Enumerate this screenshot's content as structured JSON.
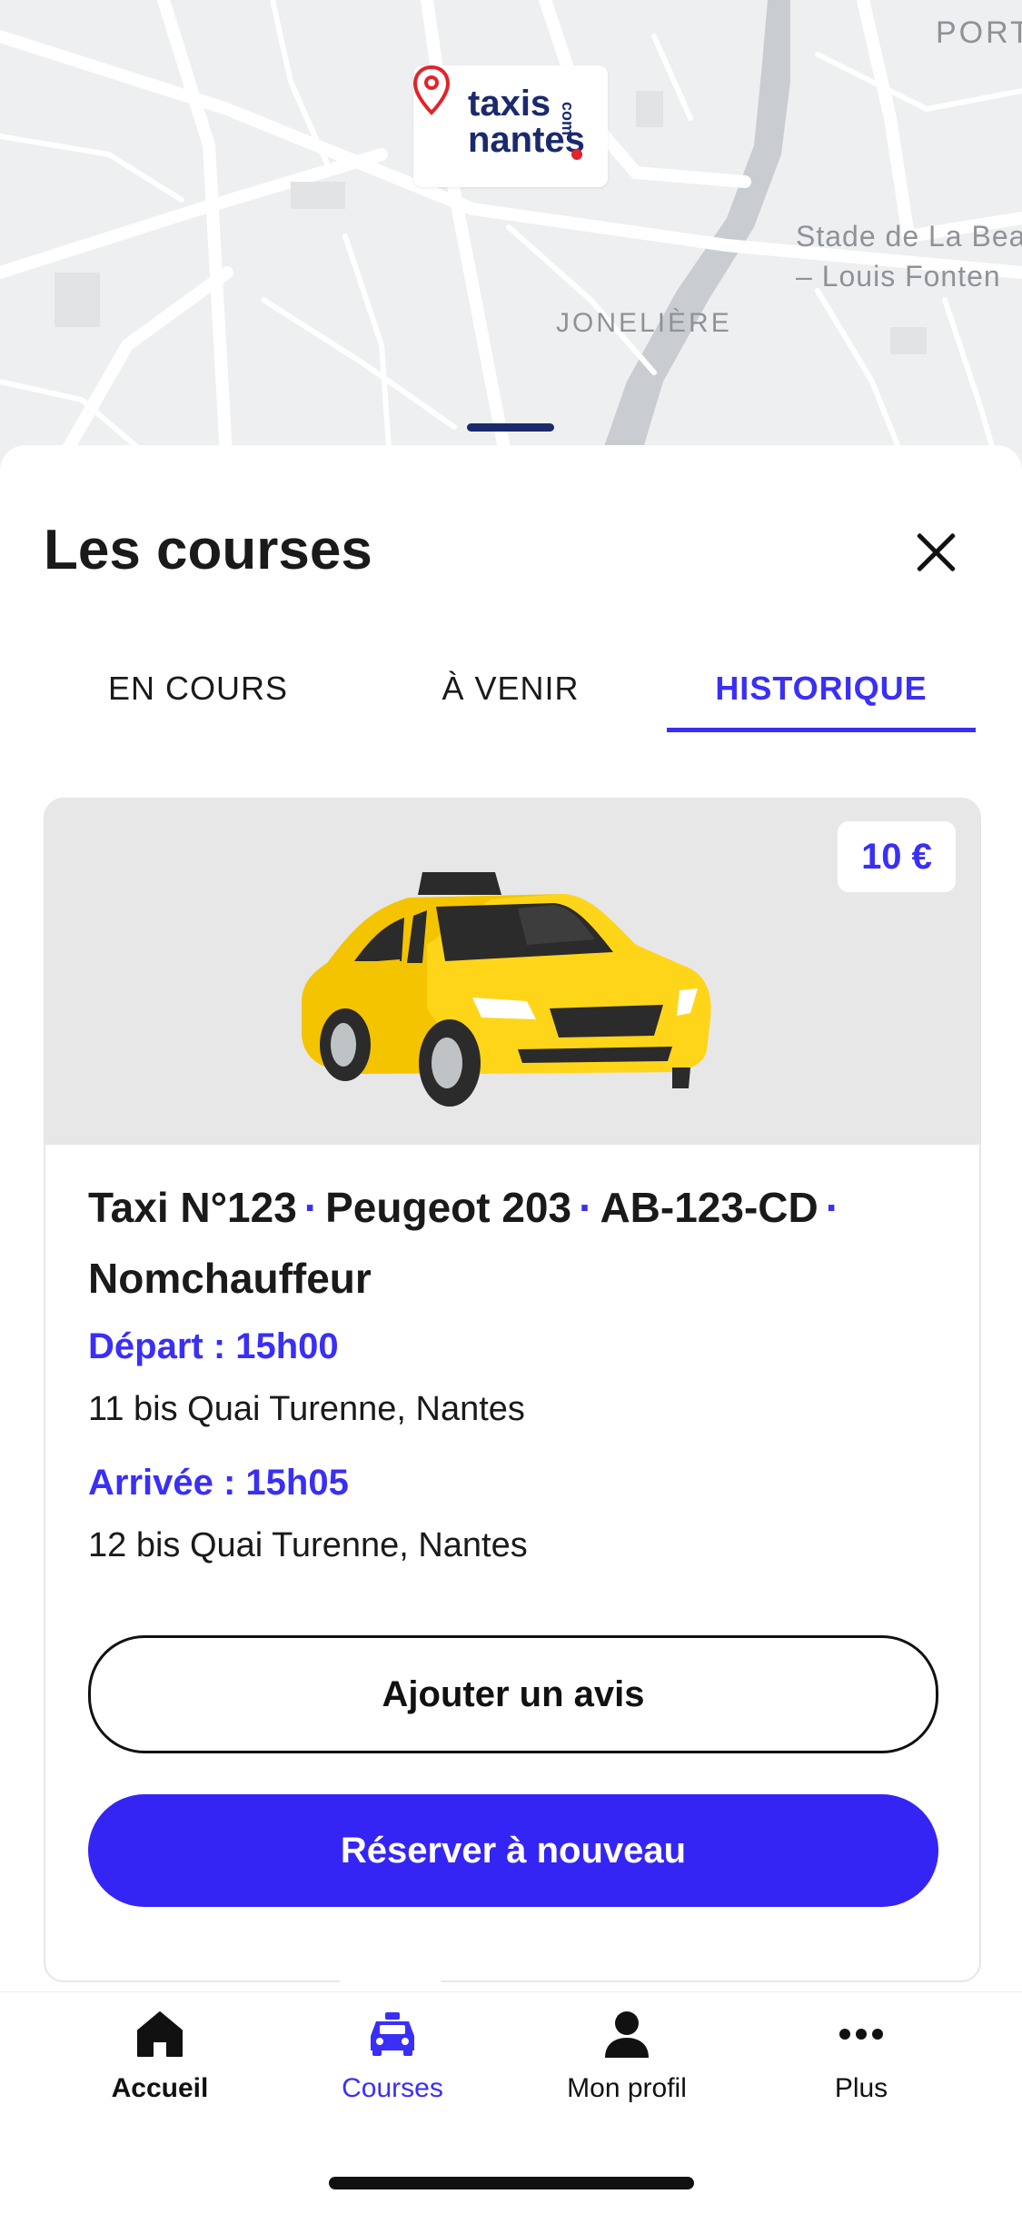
{
  "map": {
    "labels": {
      "port": "PORT",
      "stadium": "Stade de La Beau\n– Louis Fonten",
      "district": "JONELIÈRE"
    },
    "logo": {
      "line1": "taxis",
      "line2": "nantes",
      "suffix": "com"
    }
  },
  "sheet": {
    "title": "Les courses",
    "tabs": [
      {
        "label": "EN COURS",
        "active": false
      },
      {
        "label": "À VENIR",
        "active": false
      },
      {
        "label": "HISTORIQUE",
        "active": true
      }
    ]
  },
  "ride": {
    "price": "10 €",
    "taxi": "Taxi N°123",
    "model": "Peugeot 203",
    "plate": "AB-123-CD",
    "driver": "Nomchauffeur",
    "separator": "·",
    "departure_label": "Départ : 15h00",
    "departure_address": "11 bis Quai Turenne, Nantes",
    "arrival_label": "Arrivée : 15h05",
    "arrival_address": "12 bis Quai Turenne, Nantes",
    "review_button": "Ajouter un avis",
    "rebook_button": "Réserver à nouveau"
  },
  "nav": {
    "items": [
      {
        "label": "Accueil",
        "icon": "home-icon"
      },
      {
        "label": "Courses",
        "icon": "taxi-icon"
      },
      {
        "label": "Mon profil",
        "icon": "user-icon"
      },
      {
        "label": "Plus",
        "icon": "more-icon"
      }
    ]
  },
  "colors": {
    "accent": "#3a2ff5",
    "brand": "#1b2a6e",
    "taxi": "#f5c400"
  }
}
